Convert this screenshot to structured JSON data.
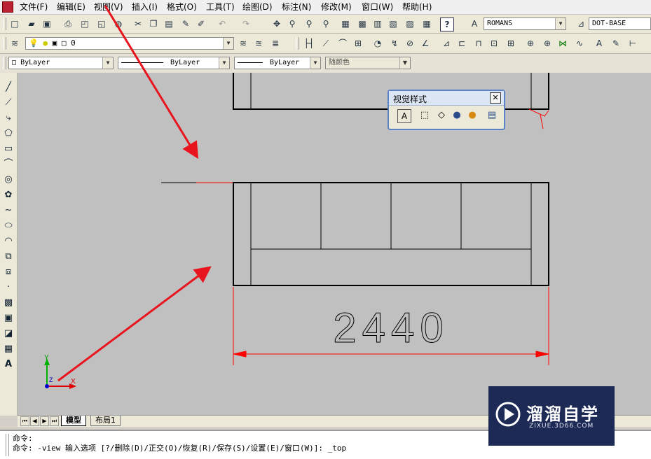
{
  "menu": [
    "文件(F)",
    "编辑(E)",
    "视图(V)",
    "插入(I)",
    "格式(O)",
    "工具(T)",
    "绘图(D)",
    "标注(N)",
    "修改(M)",
    "窗口(W)",
    "帮助(H)"
  ],
  "toolbar": {
    "text_style": "ROMANS",
    "dim_style": "DOT-BASE",
    "layer_value": "0"
  },
  "properties": {
    "color": "ByLayer",
    "linetype": "ByLayer",
    "lineweight": "ByLayer",
    "plot_style": "随颜色"
  },
  "visual_styles_panel": {
    "title": "视觉样式"
  },
  "drawing": {
    "dimension_value": "2440",
    "ucs_x": "X",
    "ucs_y": "Y",
    "ucs_z": "Z"
  },
  "tabs": {
    "model": "模型",
    "layout1": "布局1"
  },
  "command": {
    "line1": "命令:",
    "line2": "命令:  -view 输入选项 [?/删除(D)/正交(O)/恢复(R)/保存(S)/设置(E)/窗口(W)]: _top"
  },
  "watermark": {
    "brand": "溜溜自学",
    "url": "ZIXUE.3D66.COM"
  },
  "colors": {
    "canvas": "#c0c0c0",
    "dimension": "#ff0000",
    "annotation_arrow": "#e8141e",
    "watermark_bg": "#1d2a55"
  }
}
